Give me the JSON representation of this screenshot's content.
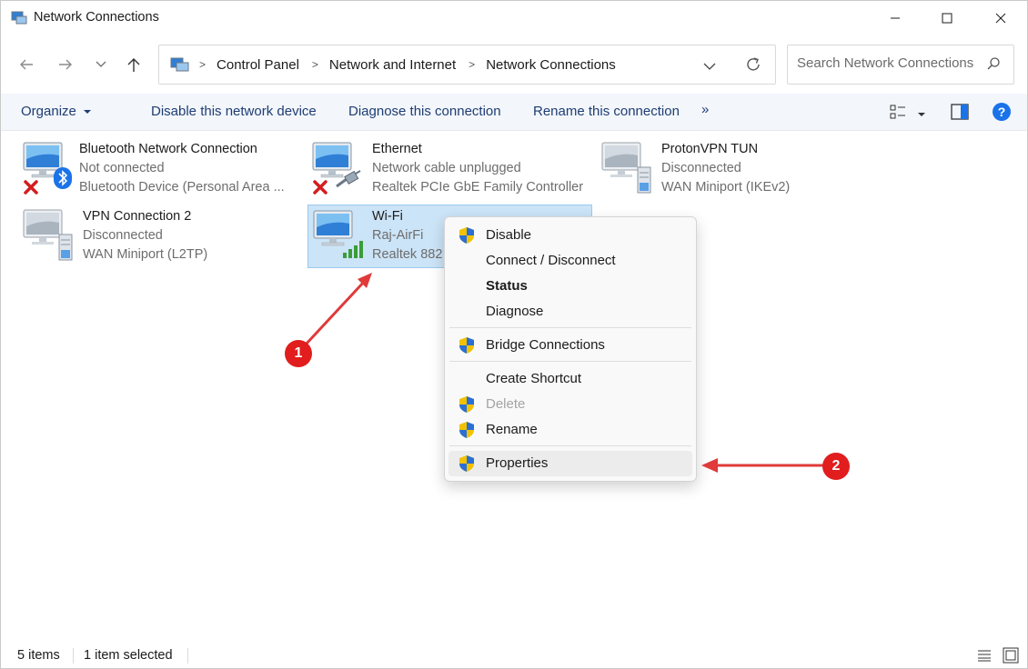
{
  "window": {
    "title": "Network Connections"
  },
  "address": {
    "crumbs": [
      "Control Panel",
      "Network and Internet",
      "Network Connections"
    ]
  },
  "search": {
    "placeholder": "Search Network Connections"
  },
  "toolbar": {
    "organize": "Organize",
    "disable": "Disable this network device",
    "diagnose": "Diagnose this connection",
    "rename": "Rename this connection",
    "more": "»"
  },
  "connections": [
    {
      "name": "Bluetooth Network Connection",
      "status": "Not connected",
      "device": "Bluetooth Device (Personal Area ...",
      "overlay": "bluetooth-icon",
      "error": true
    },
    {
      "name": "Ethernet",
      "status": "Network cable unplugged",
      "device": "Realtek PCIe GbE Family Controller",
      "overlay": "ethernet-cable-icon",
      "error": true
    },
    {
      "name": "ProtonVPN TUN",
      "status": "Disconnected",
      "device": "WAN Miniport (IKEv2)",
      "overlay": "server-icon",
      "error": false
    },
    {
      "name": "VPN Connection 2",
      "status": "Disconnected",
      "device": "WAN Miniport (L2TP)",
      "overlay": "server-icon",
      "error": false
    },
    {
      "name": "Wi-Fi",
      "status": "Raj-AirFi",
      "device": "Realtek 882",
      "overlay": "wifi-signal-icon",
      "error": false,
      "selected": true
    }
  ],
  "context_menu": {
    "items": [
      {
        "label": "Disable",
        "shield": true
      },
      {
        "label": "Connect / Disconnect",
        "shield": false
      },
      {
        "label": "Status",
        "shield": false,
        "bold": true
      },
      {
        "label": "Diagnose",
        "shield": false
      },
      {
        "label": "Bridge Connections",
        "shield": true
      },
      {
        "label": "Create Shortcut",
        "shield": false
      },
      {
        "label": "Delete",
        "shield": true,
        "disabled": true
      },
      {
        "label": "Rename",
        "shield": true
      },
      {
        "label": "Properties",
        "shield": true,
        "highlighted": true
      }
    ]
  },
  "callouts": {
    "one": "1",
    "two": "2"
  },
  "status": {
    "items": "5 items",
    "selected": "1 item selected"
  },
  "colors": {
    "accent": "#1e3d73",
    "selection": "#cce4f7",
    "callout": "#e11d1d",
    "help": "#1a73e8"
  }
}
